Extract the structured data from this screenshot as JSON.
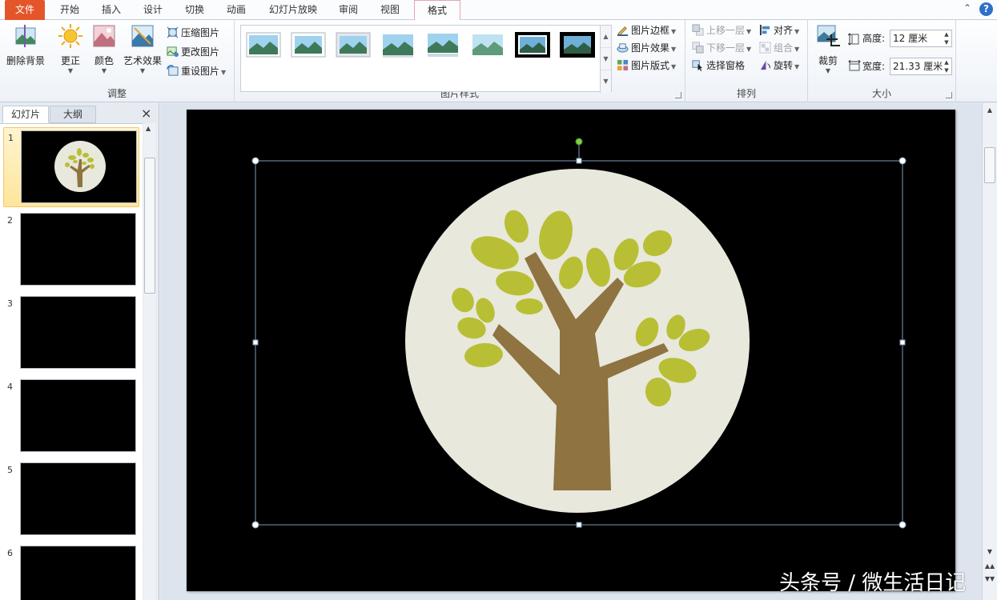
{
  "tabs": [
    {
      "label": "文件"
    },
    {
      "label": "开始"
    },
    {
      "label": "插入"
    },
    {
      "label": "设计"
    },
    {
      "label": "切换"
    },
    {
      "label": "动画"
    },
    {
      "label": "幻灯片放映"
    },
    {
      "label": "审阅"
    },
    {
      "label": "视图"
    },
    {
      "label": "格式"
    }
  ],
  "help_glyph": "?",
  "collapse_glyph": "⌃",
  "ribbon": {
    "adjust": {
      "label": "调整",
      "remove_bg": "删除背景",
      "corrections": "更正",
      "color": "颜色",
      "artistic": "艺术效果",
      "compress": "压缩图片",
      "change": "更改图片",
      "reset": "重设图片"
    },
    "styles": {
      "label": "图片样式",
      "border": "图片边框",
      "effects": "图片效果",
      "layout": "图片版式"
    },
    "arrange": {
      "label": "排列",
      "bring_forward": "上移一层",
      "send_backward": "下移一层",
      "selection_pane": "选择窗格",
      "align": "对齐",
      "group": "组合",
      "rotate": "旋转"
    },
    "size": {
      "label": "大小",
      "crop": "裁剪",
      "height_label": "高度:",
      "height_value": "12 厘米",
      "width_label": "宽度:",
      "width_value": "21.33 厘米"
    }
  },
  "panel": {
    "tab_slides": "幻灯片",
    "tab_outline": "大纲",
    "close": "×",
    "slides": [
      {
        "num": "1"
      },
      {
        "num": "2"
      },
      {
        "num": "3"
      },
      {
        "num": "4"
      },
      {
        "num": "5"
      },
      {
        "num": "6"
      }
    ]
  },
  "watermark": "头条号 / 微生活日记",
  "colors": {
    "file_tab": "#e4562a",
    "slide_bg": "#000000",
    "circle": "#e8e8dd",
    "trunk": "#8f7340",
    "leaf": "#b8bf35",
    "rotate_handle": "#7ed040",
    "help": "#2f6fc8"
  }
}
